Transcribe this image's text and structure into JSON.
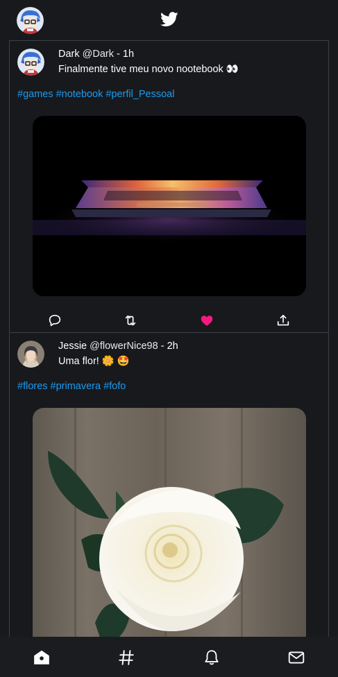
{
  "header": {
    "logo_icon": "twitter-bird-icon",
    "avatar_icon": "profile-avatar"
  },
  "tweets": [
    {
      "name": "Dark",
      "handle": "@Dark",
      "time": "- 1h",
      "text": "Finalmente tive meu novo nootebook 👀",
      "hashtags": [
        "#games",
        "#notebook",
        "#perfil_Pessoal"
      ],
      "media": "laptop-photo",
      "liked": true
    },
    {
      "name": "Jessie",
      "handle": "@flowerNice98",
      "time": "- 2h",
      "text": "Uma flor! 🌼 🤩",
      "hashtags": [
        "#flores",
        "#primavera",
        "#fofo"
      ],
      "media": "white-rose-photo",
      "liked": false
    }
  ],
  "actions": [
    "reply-icon",
    "retweet-icon",
    "like-icon",
    "share-icon"
  ],
  "bottom_nav": [
    "home-icon",
    "explore-hashtag-icon",
    "notifications-bell-icon",
    "messages-mail-icon"
  ],
  "colors": {
    "accent": "#1d9bf0",
    "like": "#f91880",
    "background": "#17191d"
  }
}
